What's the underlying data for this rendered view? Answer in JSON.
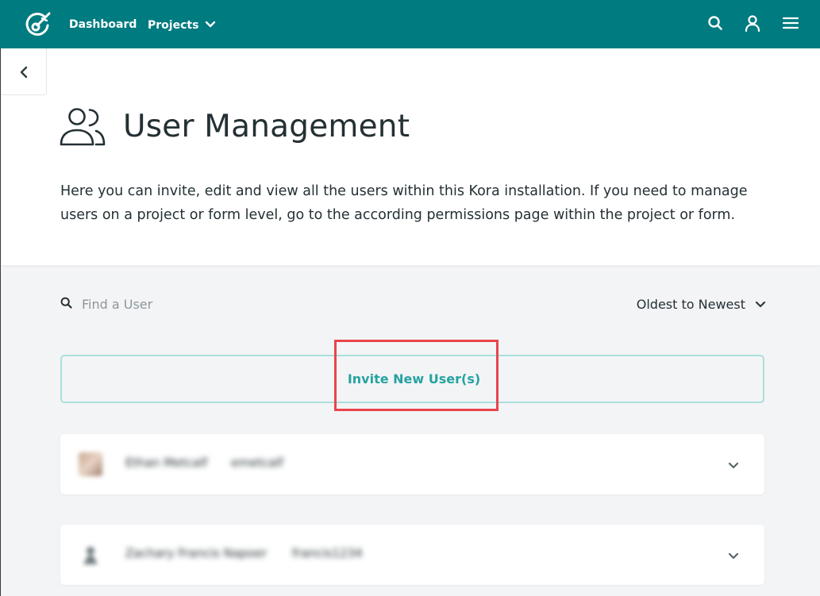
{
  "colors": {
    "brand": "#007b80",
    "accent": "#26a3a0",
    "invite_border": "#a9e0dc",
    "highlight": "#e9444c",
    "text": "#243034",
    "placeholder": "#8c969a",
    "page_bg": "#f3f4f6"
  },
  "navbar": {
    "logo_icon": "kora-logo-icon",
    "dashboard_label": "Dashboard",
    "projects_label": "Projects",
    "projects_icon": "chevron-down-icon",
    "search_icon": "search-icon",
    "profile_icon": "user-icon",
    "menu_icon": "hamburger-menu-icon"
  },
  "sidebar_toggle": {
    "icon": "chevron-left-icon"
  },
  "header": {
    "icon": "users-icon",
    "title": "User Management",
    "description": "Here you can invite, edit and view all the users within this Kora installation. If you need to manage users on a project or form level, go to the according permissions page within the project or form."
  },
  "controls": {
    "search_placeholder": "Find a User",
    "search_value": "",
    "sort_selected": "Oldest to Newest",
    "invite_label": "Invite New User(s)"
  },
  "users": [
    {
      "name": "Ethan Metcalf",
      "username": "emetcalf",
      "avatar": "photo"
    },
    {
      "name": "Zachary Francis Napoer",
      "username": "francis1234",
      "avatar": "generic-user-icon"
    }
  ]
}
